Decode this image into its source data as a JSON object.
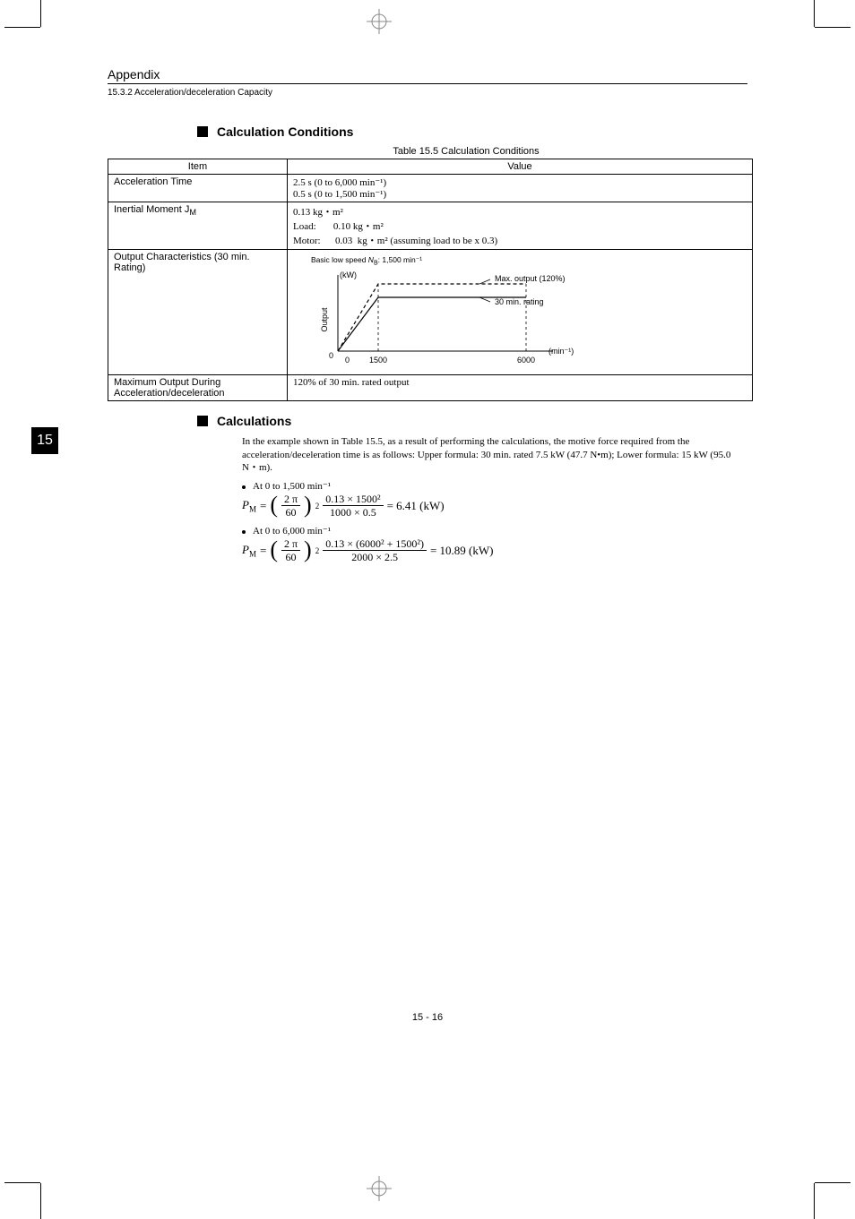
{
  "header": {
    "appendix": "Appendix",
    "subsection": "15.3.2 Acceleration/deceleration Capacity"
  },
  "side_tab": "15",
  "section1": {
    "heading": "Calculation Conditions",
    "table_caption": "Table 15.5   Calculation Conditions",
    "col_item": "Item",
    "col_value": "Value",
    "rows": {
      "r1_item": "Acceleration Time",
      "r1_val_line1": "2.5 s (0 to 6,000 min⁻¹)",
      "r1_val_line2": "0.5 s (0 to 1,500 min⁻¹)",
      "r2_item": "Inertial Moment J",
      "r2_item_sub": "M",
      "r2_val_line1": "0.13 kg・m²",
      "r2_val_line2": "Load:       0.10 kg・m²",
      "r2_val_line3": "Motor:      0.03  kg・m² (assuming load to be x 0.3)",
      "r3_item": "Output Characteristics (30 min. Rating)",
      "r4_item": "Maximum Output During Acceleration/deceleration",
      "r4_val": "120% of 30 min. rated output"
    }
  },
  "chart_data": {
    "type": "line",
    "basic_low_speed_label": "Basic low speed",
    "basic_low_speed_var": "N",
    "basic_low_speed_sub": "B",
    "basic_low_speed_val": ": 1,500 min⁻¹",
    "y_unit": "(kW)",
    "y_axis_label": "Output",
    "x_unit": "(min⁻¹)",
    "x_ticks": [
      "0",
      "1500",
      "6000"
    ],
    "y_zero": "0",
    "series": [
      {
        "name": "Max. output (120%)",
        "points": [
          [
            0,
            0
          ],
          [
            1500,
            1.2
          ],
          [
            6000,
            1.2
          ]
        ]
      },
      {
        "name": "30 min. rating",
        "points": [
          [
            0,
            0
          ],
          [
            1500,
            1.0
          ],
          [
            6000,
            1.0
          ]
        ]
      }
    ],
    "xlim": [
      0,
      6000
    ],
    "ylim": [
      0,
      1.3
    ]
  },
  "section2": {
    "heading": "Calculations",
    "intro": "In the example shown in Table 15.5, as a result of performing the calculations, the motive force required from the acceleration/deceleration time is as follows: Upper formula: 30 min. rated 7.5 kW (47.7 N•m); Lower formula: 15 kW (95.0 N・m).",
    "bullet1": "At 0 to 1,500 min⁻¹",
    "bullet2": "At 0 to 6,000 min⁻¹",
    "formula1": {
      "lhs_var": "P",
      "lhs_sub": "M",
      "f1_num": "2 π",
      "f1_den": "60",
      "exp2": "2",
      "f2_num": "0.13 × 1500²",
      "f2_den": "1000 × 0.5",
      "result": "= 6.41 (kW)"
    },
    "formula2": {
      "lhs_var": "P",
      "lhs_sub": "M",
      "f1_num": "2 π",
      "f1_den": "60",
      "exp2": "2",
      "f2_num": "0.13 × (6000² + 1500²)",
      "f2_den": "2000 × 2.5",
      "result": "=  10.89  (kW)"
    }
  },
  "page_number": "15 - 16"
}
